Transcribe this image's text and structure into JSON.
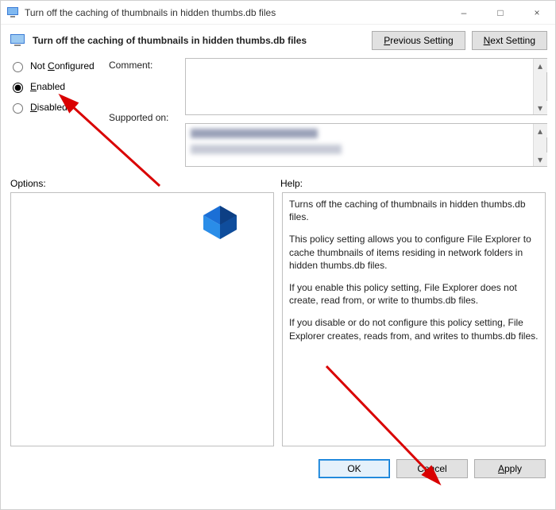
{
  "window": {
    "title": "Turn off the caching of thumbnails in hidden thumbs.db files",
    "minimize": "–",
    "maximize": "□",
    "close": "×"
  },
  "header": {
    "title": "Turn off the caching of thumbnails in hidden thumbs.db files",
    "prev_prefix": "P",
    "prev_rest": "revious Setting",
    "next_prefix": "N",
    "next_rest": "ext Setting"
  },
  "radios": {
    "not_configured_prefix": "Not ",
    "not_configured_mn": "C",
    "not_configured_rest": "onfigured",
    "enabled_mn": "E",
    "enabled_rest": "nabled",
    "disabled_mn": "D",
    "disabled_rest": "isabled",
    "selected": "enabled"
  },
  "labels": {
    "comment": "Comment:",
    "supported_on": "Supported on:",
    "options": "Options:",
    "help": "Help:"
  },
  "help": {
    "p1": "Turns off the caching of thumbnails in hidden thumbs.db files.",
    "p2": "This policy setting allows you to configure File Explorer to cache thumbnails of items residing in network folders in hidden thumbs.db files.",
    "p3": "If you enable this policy setting, File Explorer does not create, read from, or write to thumbs.db files.",
    "p4": "If you disable or do not configure this policy setting, File Explorer creates, reads from, and writes to thumbs.db files."
  },
  "footer": {
    "ok": "OK",
    "cancel": "Cancel",
    "apply_mn": "A",
    "apply_rest": "pply"
  }
}
